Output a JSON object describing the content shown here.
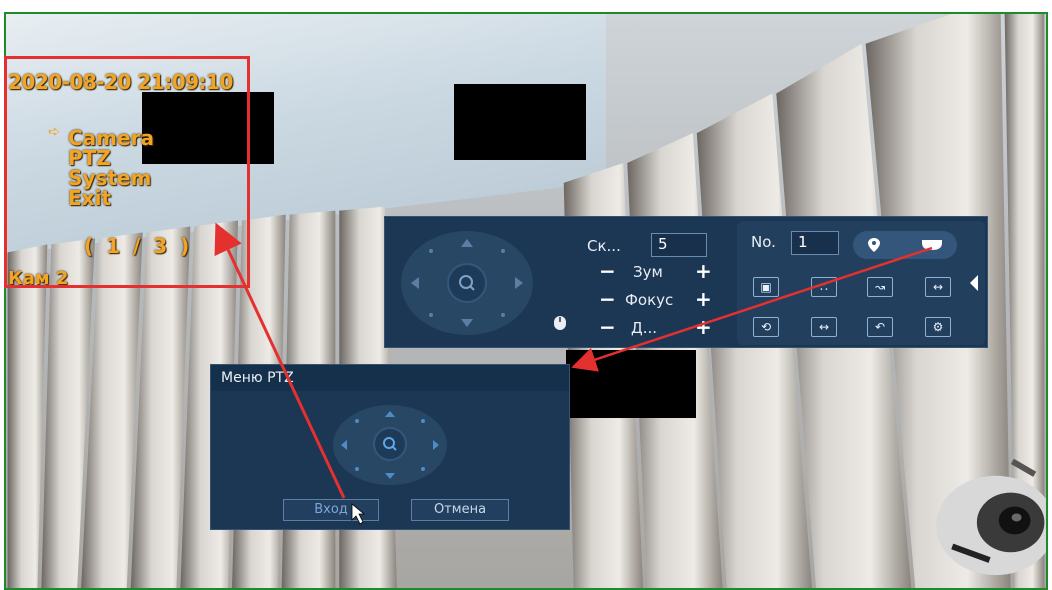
{
  "osd": {
    "timestamp": "2020-08-20 21:09:10",
    "menu_items": [
      "Camera",
      "PTZ",
      "System",
      "Exit"
    ],
    "page": "( 1 / 3 )",
    "camera_name": "Кам 2"
  },
  "ptz_panel": {
    "speed_label": "Ск...",
    "speed_value": "5",
    "zoom_label": "Зум",
    "focus_label": "Фокус",
    "iris_label": "Д...",
    "minus": "−",
    "plus": "+",
    "preset_label": "No.",
    "preset_value": "1",
    "icons": [
      "location-pin-icon",
      "dome-camera-icon",
      "camera-icon",
      "tour-icon",
      "pattern-icon",
      "scan-icon",
      "rotate-icon",
      "flip-icon",
      "return-icon",
      "settings-icon",
      "collapse-arrow-icon",
      "mouse-icon"
    ]
  },
  "ptz_dialog": {
    "title": "Меню PTZ",
    "enter_label": "Вход",
    "cancel_label": "Отмена"
  },
  "colors": {
    "osd_text": "#f0a526",
    "highlight_box": "#e53030",
    "panel_bg": "#1c3754",
    "frame_border": "#1f8a2a"
  }
}
